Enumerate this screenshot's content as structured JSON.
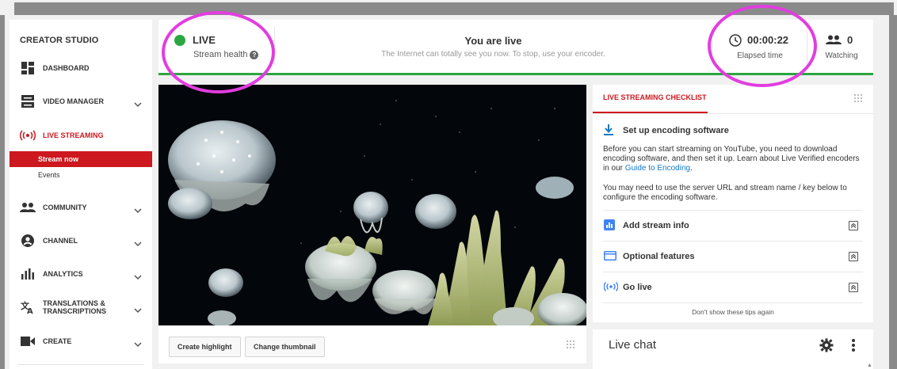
{
  "sidebar": {
    "title": "CREATOR STUDIO",
    "items": [
      {
        "label": "DASHBOARD",
        "icon": "dashboard-icon"
      },
      {
        "label": "VIDEO MANAGER",
        "icon": "video-manager-icon"
      },
      {
        "label": "LIVE STREAMING",
        "icon": "live-icon"
      },
      {
        "label": "COMMUNITY",
        "icon": "people-icon"
      },
      {
        "label": "CHANNEL",
        "icon": "account-icon"
      },
      {
        "label": "ANALYTICS",
        "icon": "bar-chart-icon"
      },
      {
        "label": "TRANSLATIONS & TRANSCRIPTIONS",
        "label1": "TRANSLATIONS &",
        "label2": "TRANSCRIPTIONS",
        "icon": "translate-icon"
      },
      {
        "label": "CREATE",
        "icon": "camera-icon"
      }
    ],
    "subitems": [
      {
        "label": "Stream now",
        "active": true
      },
      {
        "label": "Events",
        "active": false
      }
    ]
  },
  "header": {
    "status": "LIVE",
    "stream_health": "Stream health",
    "headline": "You are live",
    "subline": "The Internet can totally see you now. To stop, use your encoder.",
    "elapsed": "00:00:22",
    "elapsed_label": "Elapsed time",
    "watching_count": "0",
    "watching_label": "Watching"
  },
  "video": {
    "create_highlight": "Create highlight",
    "change_thumbnail": "Change thumbnail"
  },
  "checklist": {
    "tab": "LIVE STREAMING CHECKLIST",
    "step1_title": "Set up encoding software",
    "para1_a": "Before you can start streaming on YouTube, you need to download encoding software, and then set it up. Learn about Live Verified encoders in our ",
    "para1_link": "Guide to Encoding",
    "para1_end": ".",
    "para2": "You may need to use the server URL and stream name / key below to configure the encoding software.",
    "steps": [
      {
        "title": "Add stream info",
        "icon": "stream-info-icon"
      },
      {
        "title": "Optional features",
        "icon": "features-icon"
      },
      {
        "title": "Go live",
        "icon": "broadcast-icon"
      }
    ],
    "dont_show": "Don't show these tips again"
  },
  "livechat": {
    "title": "Live chat"
  },
  "colors": {
    "accent_red": "#cc181e",
    "live_green": "#2ba640",
    "link_blue": "#167ac6",
    "annotation_magenta": "#e23de0"
  }
}
